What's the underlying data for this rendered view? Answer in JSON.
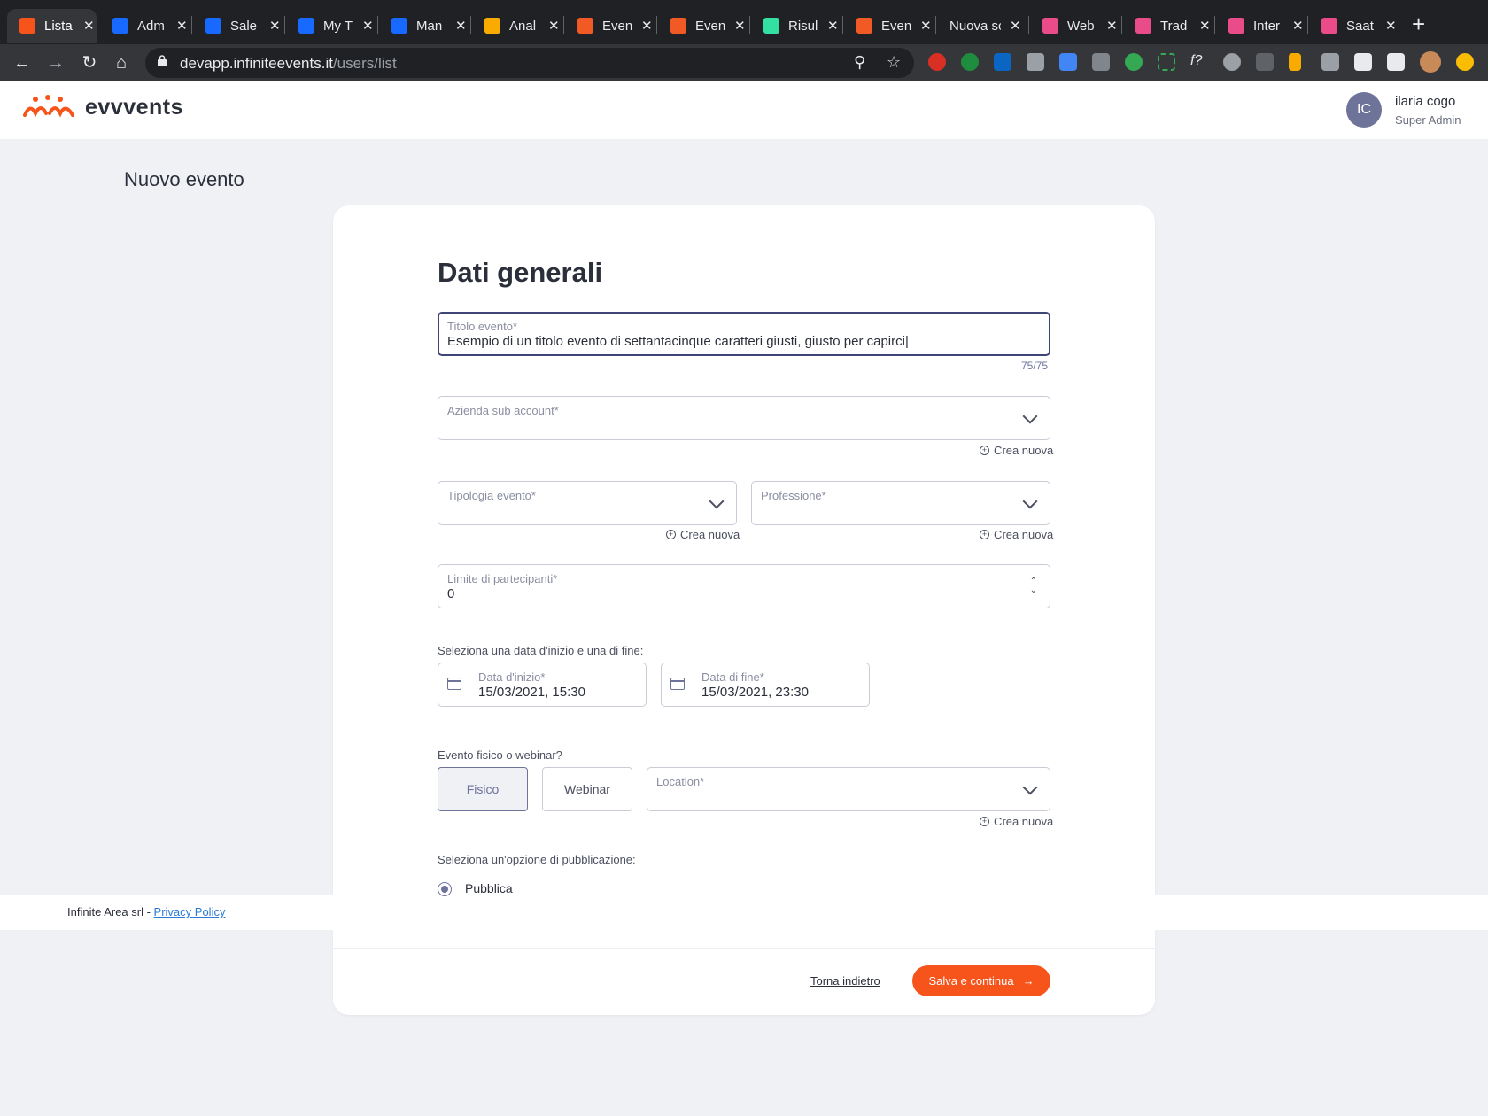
{
  "browser": {
    "tabs": [
      {
        "title": "Lista",
        "favicon": "evvvents-icon",
        "color": "#f7541c",
        "active": true
      },
      {
        "title": "Adm",
        "favicon": "behance-icon",
        "color": "#1769ff"
      },
      {
        "title": "Sale",
        "favicon": "behance-icon",
        "color": "#1769ff"
      },
      {
        "title": "My T",
        "favicon": "behance-icon",
        "color": "#1769ff"
      },
      {
        "title": "Man",
        "favicon": "behance-icon",
        "color": "#1769ff"
      },
      {
        "title": "Anal",
        "favicon": "analytics-icon",
        "color": "#f9ab00"
      },
      {
        "title": "Even",
        "favicon": "e-icon",
        "color": "#f15a24"
      },
      {
        "title": "Even",
        "favicon": "e-icon",
        "color": "#f15a24"
      },
      {
        "title": "Risul",
        "favicon": "tripadvisor-icon",
        "color": "#34e0a1"
      },
      {
        "title": "Even",
        "favicon": "e-icon",
        "color": "#f15a24"
      },
      {
        "title": "Nuova sc",
        "favicon": "",
        "color": ""
      },
      {
        "title": "Web",
        "favicon": "dribbble-icon",
        "color": "#ea4c89"
      },
      {
        "title": "Trad",
        "favicon": "dribbble-icon",
        "color": "#ea4c89"
      },
      {
        "title": "Inter",
        "favicon": "dribbble-icon",
        "color": "#ea4c89"
      },
      {
        "title": "Saat",
        "favicon": "dribbble-icon",
        "color": "#ea4c89"
      }
    ],
    "url_host": "devapp.infiniteevents.it",
    "url_path": "/users/list"
  },
  "header": {
    "logo_text": "evvvents",
    "avatar_initials": "IC",
    "user_name": "ilaria cogo",
    "user_role": "Super Admin"
  },
  "page": {
    "title": "Nuovo evento",
    "section_title": "Dati generali"
  },
  "form": {
    "titolo": {
      "label": "Titolo evento*",
      "value": "Esempio di un titolo evento di settantacinque caratteri giusti, giusto per capirci|",
      "counter": "75/75"
    },
    "azienda": {
      "label": "Azienda sub account*",
      "value": ""
    },
    "tipologia": {
      "label": "Tipologia evento*",
      "value": ""
    },
    "professione": {
      "label": "Professione*",
      "value": ""
    },
    "limite": {
      "label": "Limite di partecipanti*",
      "value": "0"
    },
    "date_hint": "Seleziona una data d'inizio e una di fine:",
    "data_inizio": {
      "label": "Data d'inizio*",
      "value": "15/03/2021, 15:30"
    },
    "data_fine": {
      "label": "Data di fine*",
      "value": "15/03/2021, 23:30"
    },
    "tipo_hint": "Evento fisico o webinar?",
    "fisico_label": "Fisico",
    "webinar_label": "Webinar",
    "location": {
      "label": "Location*",
      "value": ""
    },
    "pubblicazione_hint": "Seleziona un'opzione di pubblicazione:",
    "pubblica_label": "Pubblica",
    "crea_nuova": "Crea nuova"
  },
  "footer": {
    "company": "Infinite Area srl - ",
    "privacy": "Privacy Policy"
  },
  "actions": {
    "back": "Torna indietro",
    "save": "Salva e continua"
  },
  "colors": {
    "accent": "#f7541c",
    "primary": "#3e4478"
  }
}
